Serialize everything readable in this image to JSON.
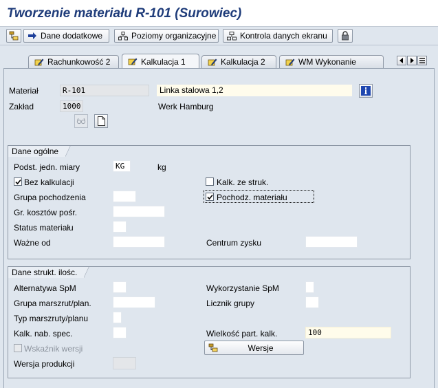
{
  "window": {
    "title": "Tworzenie materiału R-101 (Surowiec)"
  },
  "toolbar": {
    "buttons": [
      {
        "label": "",
        "icon": "hierarchy-icon"
      },
      {
        "label": "Dane dodatkowe",
        "icon": "arrow-right-icon"
      },
      {
        "label": "Poziomy organizacyjne",
        "icon": "org-levels-icon"
      },
      {
        "label": "Kontrola danych ekranu",
        "icon": "check-data-icon"
      },
      {
        "label": "",
        "icon": "lock-icon"
      }
    ]
  },
  "tabs": [
    {
      "label": "Rachunkowość 2",
      "active": false
    },
    {
      "label": "Kalkulacja 1",
      "active": true
    },
    {
      "label": "Kalkulacja 2",
      "active": false
    },
    {
      "label": "WM Wykonanie",
      "active": false
    }
  ],
  "header": {
    "material_label": "Materiał",
    "material_value": "R-101",
    "material_desc": "Linka stalowa 1,2",
    "plant_label": "Zakład",
    "plant_value": "1000",
    "plant_desc": "Werk Hamburg"
  },
  "general": {
    "title": "Dane ogólne",
    "base_uom_label": "Podst. jedn. miary",
    "base_uom_value": "KG",
    "base_uom_text": "kg",
    "no_costing_label": "Bez kalkulacji",
    "no_costing_checked": true,
    "costing_struct_label": "Kalk. ze struk.",
    "costing_struct_checked": false,
    "origin_group_label": "Grupa pochodzenia",
    "material_origin_label": "Pochodz. materiału",
    "material_origin_checked": true,
    "overhead_group_label": "Gr. kosztów pośr.",
    "material_status_label": "Status materiału",
    "valid_from_label": "Ważne od",
    "profit_center_label": "Centrum zysku"
  },
  "quantity": {
    "title": "Dane strukt. ilośc.",
    "alt_bom_label": "Alternatywa SpM",
    "bom_usage_label": "Wykorzystanie SpM",
    "routing_group_label": "Grupa marszrut/plan.",
    "group_counter_label": "Licznik grupy",
    "routing_type_label": "Typ marszruty/planu",
    "special_procurement_label": "Kalk. nab. spec.",
    "costing_lot_size_label": "Wielkość part. kalk.",
    "costing_lot_size_value": "100",
    "version_indicator_label": "Wskaźnik wersji",
    "versions_button_label": "Wersje",
    "production_version_label": "Wersja produkcji"
  },
  "colors": {
    "title": "#1f3c7a",
    "background": "#dfe6ee",
    "input": "#fffceb"
  }
}
